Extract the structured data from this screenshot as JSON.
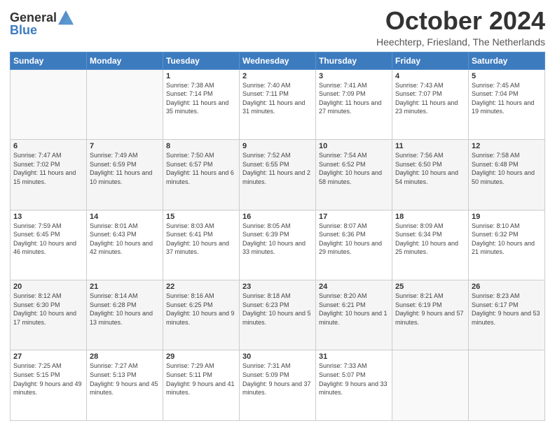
{
  "header": {
    "logo_general": "General",
    "logo_blue": "Blue",
    "month_title": "October 2024",
    "location": "Heechterp, Friesland, The Netherlands"
  },
  "days_of_week": [
    "Sunday",
    "Monday",
    "Tuesday",
    "Wednesday",
    "Thursday",
    "Friday",
    "Saturday"
  ],
  "weeks": [
    [
      {
        "day": "",
        "info": ""
      },
      {
        "day": "",
        "info": ""
      },
      {
        "day": "1",
        "info": "Sunrise: 7:38 AM\nSunset: 7:14 PM\nDaylight: 11 hours and 35 minutes."
      },
      {
        "day": "2",
        "info": "Sunrise: 7:40 AM\nSunset: 7:11 PM\nDaylight: 11 hours and 31 minutes."
      },
      {
        "day": "3",
        "info": "Sunrise: 7:41 AM\nSunset: 7:09 PM\nDaylight: 11 hours and 27 minutes."
      },
      {
        "day": "4",
        "info": "Sunrise: 7:43 AM\nSunset: 7:07 PM\nDaylight: 11 hours and 23 minutes."
      },
      {
        "day": "5",
        "info": "Sunrise: 7:45 AM\nSunset: 7:04 PM\nDaylight: 11 hours and 19 minutes."
      }
    ],
    [
      {
        "day": "6",
        "info": "Sunrise: 7:47 AM\nSunset: 7:02 PM\nDaylight: 11 hours and 15 minutes."
      },
      {
        "day": "7",
        "info": "Sunrise: 7:49 AM\nSunset: 6:59 PM\nDaylight: 11 hours and 10 minutes."
      },
      {
        "day": "8",
        "info": "Sunrise: 7:50 AM\nSunset: 6:57 PM\nDaylight: 11 hours and 6 minutes."
      },
      {
        "day": "9",
        "info": "Sunrise: 7:52 AM\nSunset: 6:55 PM\nDaylight: 11 hours and 2 minutes."
      },
      {
        "day": "10",
        "info": "Sunrise: 7:54 AM\nSunset: 6:52 PM\nDaylight: 10 hours and 58 minutes."
      },
      {
        "day": "11",
        "info": "Sunrise: 7:56 AM\nSunset: 6:50 PM\nDaylight: 10 hours and 54 minutes."
      },
      {
        "day": "12",
        "info": "Sunrise: 7:58 AM\nSunset: 6:48 PM\nDaylight: 10 hours and 50 minutes."
      }
    ],
    [
      {
        "day": "13",
        "info": "Sunrise: 7:59 AM\nSunset: 6:45 PM\nDaylight: 10 hours and 46 minutes."
      },
      {
        "day": "14",
        "info": "Sunrise: 8:01 AM\nSunset: 6:43 PM\nDaylight: 10 hours and 42 minutes."
      },
      {
        "day": "15",
        "info": "Sunrise: 8:03 AM\nSunset: 6:41 PM\nDaylight: 10 hours and 37 minutes."
      },
      {
        "day": "16",
        "info": "Sunrise: 8:05 AM\nSunset: 6:39 PM\nDaylight: 10 hours and 33 minutes."
      },
      {
        "day": "17",
        "info": "Sunrise: 8:07 AM\nSunset: 6:36 PM\nDaylight: 10 hours and 29 minutes."
      },
      {
        "day": "18",
        "info": "Sunrise: 8:09 AM\nSunset: 6:34 PM\nDaylight: 10 hours and 25 minutes."
      },
      {
        "day": "19",
        "info": "Sunrise: 8:10 AM\nSunset: 6:32 PM\nDaylight: 10 hours and 21 minutes."
      }
    ],
    [
      {
        "day": "20",
        "info": "Sunrise: 8:12 AM\nSunset: 6:30 PM\nDaylight: 10 hours and 17 minutes."
      },
      {
        "day": "21",
        "info": "Sunrise: 8:14 AM\nSunset: 6:28 PM\nDaylight: 10 hours and 13 minutes."
      },
      {
        "day": "22",
        "info": "Sunrise: 8:16 AM\nSunset: 6:25 PM\nDaylight: 10 hours and 9 minutes."
      },
      {
        "day": "23",
        "info": "Sunrise: 8:18 AM\nSunset: 6:23 PM\nDaylight: 10 hours and 5 minutes."
      },
      {
        "day": "24",
        "info": "Sunrise: 8:20 AM\nSunset: 6:21 PM\nDaylight: 10 hours and 1 minute."
      },
      {
        "day": "25",
        "info": "Sunrise: 8:21 AM\nSunset: 6:19 PM\nDaylight: 9 hours and 57 minutes."
      },
      {
        "day": "26",
        "info": "Sunrise: 8:23 AM\nSunset: 6:17 PM\nDaylight: 9 hours and 53 minutes."
      }
    ],
    [
      {
        "day": "27",
        "info": "Sunrise: 7:25 AM\nSunset: 5:15 PM\nDaylight: 9 hours and 49 minutes."
      },
      {
        "day": "28",
        "info": "Sunrise: 7:27 AM\nSunset: 5:13 PM\nDaylight: 9 hours and 45 minutes."
      },
      {
        "day": "29",
        "info": "Sunrise: 7:29 AM\nSunset: 5:11 PM\nDaylight: 9 hours and 41 minutes."
      },
      {
        "day": "30",
        "info": "Sunrise: 7:31 AM\nSunset: 5:09 PM\nDaylight: 9 hours and 37 minutes."
      },
      {
        "day": "31",
        "info": "Sunrise: 7:33 AM\nSunset: 5:07 PM\nDaylight: 9 hours and 33 minutes."
      },
      {
        "day": "",
        "info": ""
      },
      {
        "day": "",
        "info": ""
      }
    ]
  ]
}
